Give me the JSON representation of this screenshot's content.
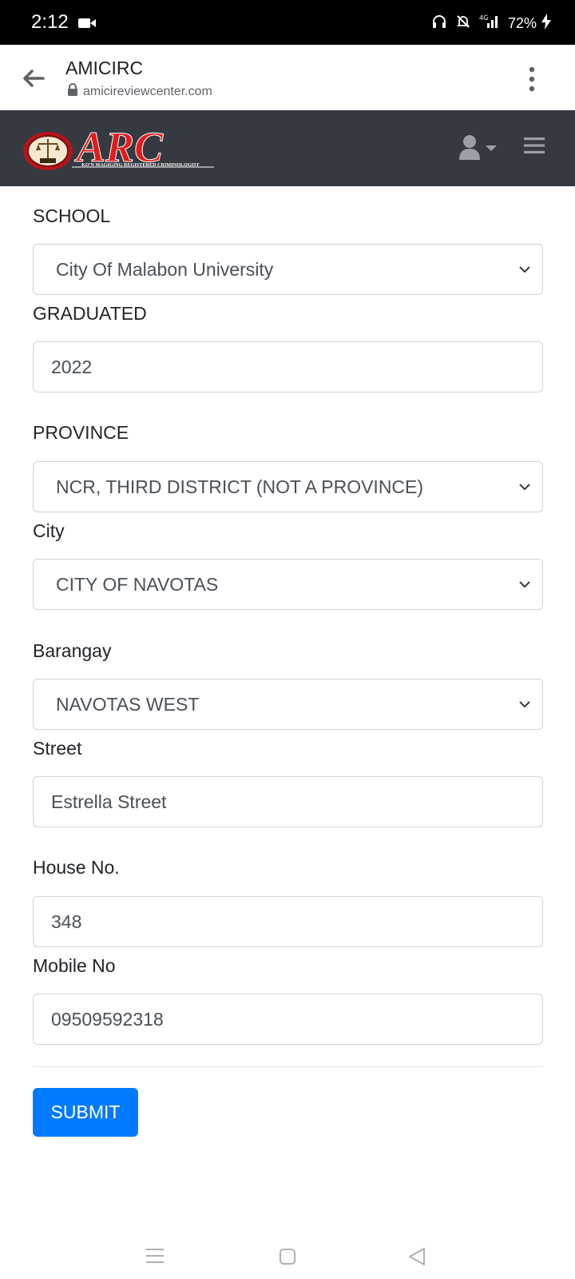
{
  "status": {
    "time": "2:12",
    "network": "4G",
    "battery": "72%"
  },
  "browser": {
    "site_title": "AMICIRC",
    "url": "amicireviewcenter.com"
  },
  "navbar": {
    "logo_text": "ARC",
    "logo_tagline": "KO'N MAGIGING REGISTERED CRIMINOLOGIST"
  },
  "form": {
    "school": {
      "label": "SCHOOL",
      "value": "City Of Malabon University"
    },
    "graduated": {
      "label": "GRADUATED",
      "value": "2022"
    },
    "province": {
      "label": "PROVINCE",
      "value": "NCR, THIRD DISTRICT (NOT A PROVINCE)"
    },
    "city": {
      "label": "City",
      "value": "CITY OF NAVOTAS"
    },
    "barangay": {
      "label": "Barangay",
      "value": "NAVOTAS WEST"
    },
    "street": {
      "label": "Street",
      "value": "Estrella Street"
    },
    "house_no": {
      "label": "House No.",
      "value": "348"
    },
    "mobile_no": {
      "label": "Mobile No",
      "value": "09509592318"
    },
    "submit_label": "SUBMIT"
  },
  "colors": {
    "navbar_bg": "#343a40",
    "primary": "#007bff",
    "logo_red": "#e31b1b"
  }
}
